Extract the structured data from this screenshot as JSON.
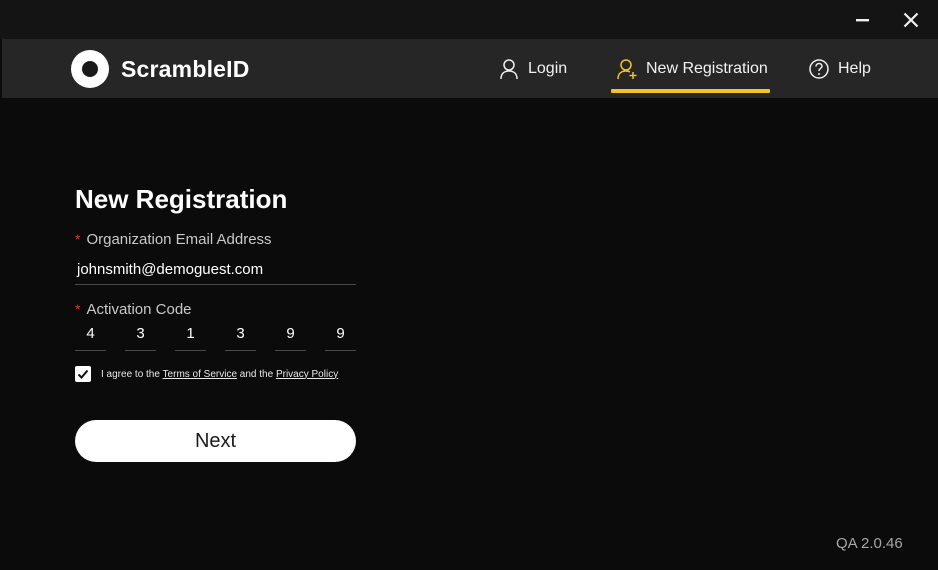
{
  "app": {
    "name": "ScrambleID",
    "version": "QA 2.0.46"
  },
  "window_controls": {
    "minimize_icon": "minimize-icon",
    "close_icon": "close-icon"
  },
  "nav": {
    "items": [
      {
        "label": "Login",
        "icon": "user-icon",
        "active": false
      },
      {
        "label": "New Registration",
        "icon": "user-add-icon",
        "active": true
      },
      {
        "label": "Help",
        "icon": "help-icon",
        "active": false
      }
    ],
    "active_color": "#f5c226"
  },
  "form": {
    "title": "New Registration",
    "required_marker": "*",
    "email_label": "Organization Email Address",
    "email_value": "johnsmith@demoguest.com",
    "code_label": "Activation Code",
    "code_digits": [
      "4",
      "3",
      "1",
      "3",
      "9",
      "9"
    ],
    "agree": {
      "checked": true,
      "prefix": "I agree to the",
      "terms_link": "Terms of Service",
      "middle": "and the",
      "privacy_link": "Privacy Policy"
    },
    "next_label": "Next"
  }
}
